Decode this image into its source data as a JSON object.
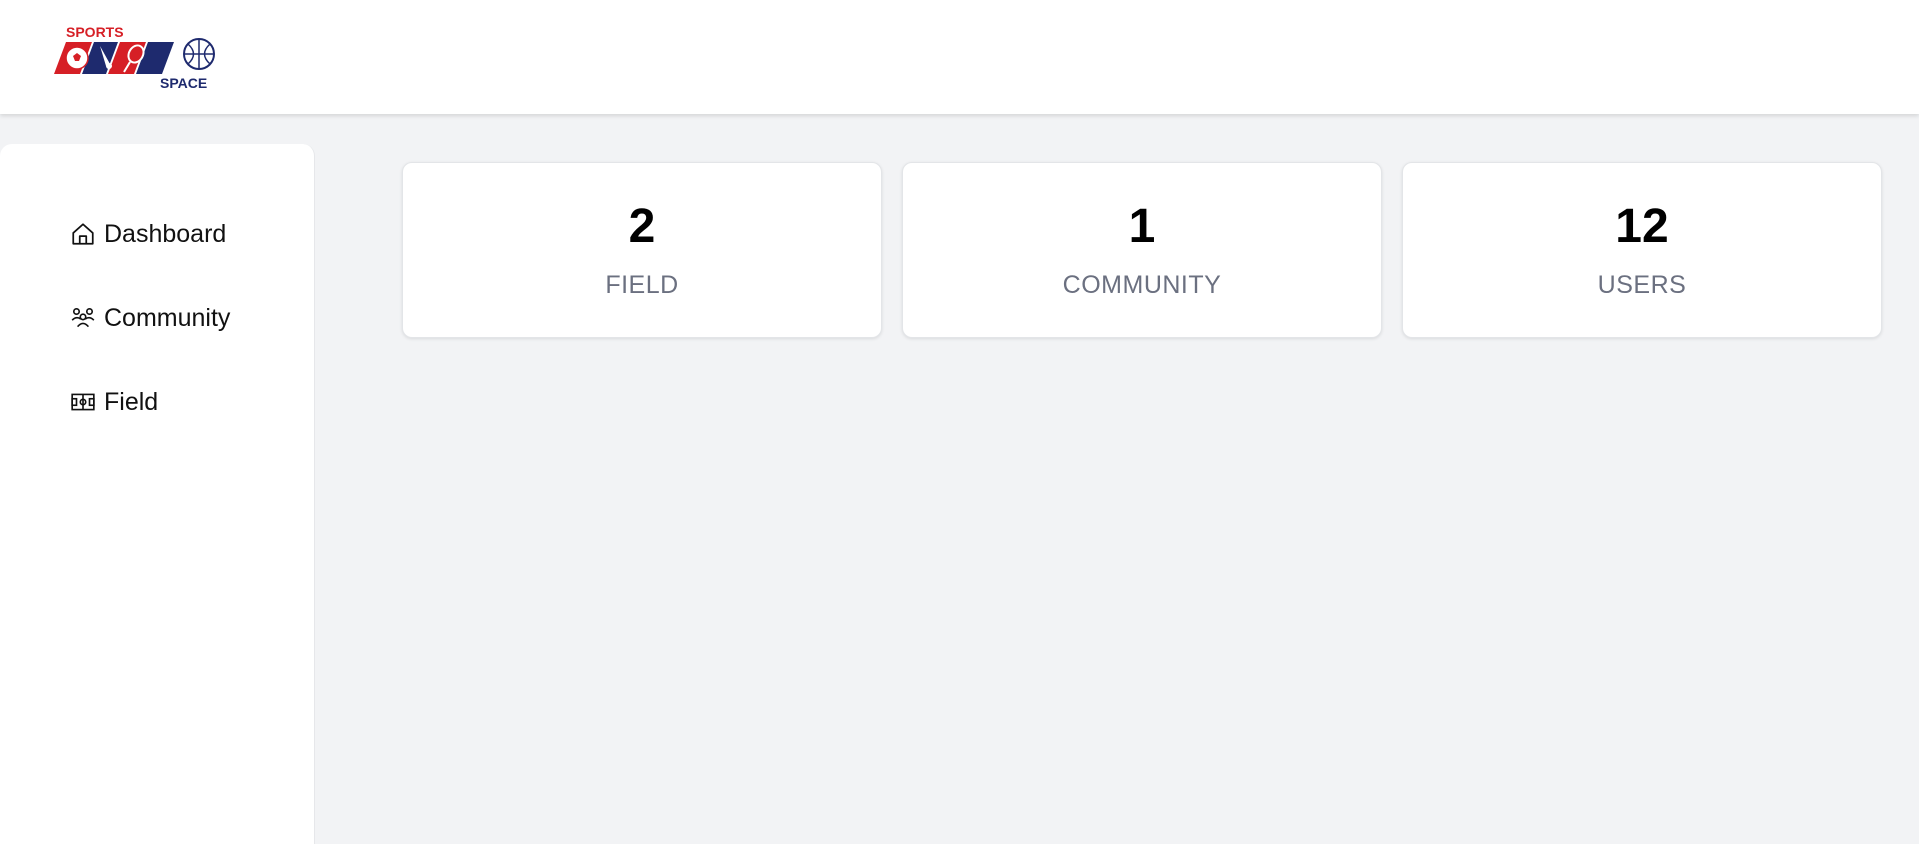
{
  "brand": {
    "logo_text_top": "SPORTS",
    "logo_text_bottom": "SPACE",
    "colors": {
      "red": "#d61f26",
      "navy": "#1e2a6e"
    }
  },
  "sidebar": {
    "items": [
      {
        "label": "Dashboard",
        "icon": "home-icon"
      },
      {
        "label": "Community",
        "icon": "users-icon"
      },
      {
        "label": "Field",
        "icon": "field-icon"
      }
    ]
  },
  "stats": [
    {
      "value": "2",
      "label": "FIELD"
    },
    {
      "value": "1",
      "label": "COMMUNITY"
    },
    {
      "value": "12",
      "label": "USERS"
    }
  ]
}
